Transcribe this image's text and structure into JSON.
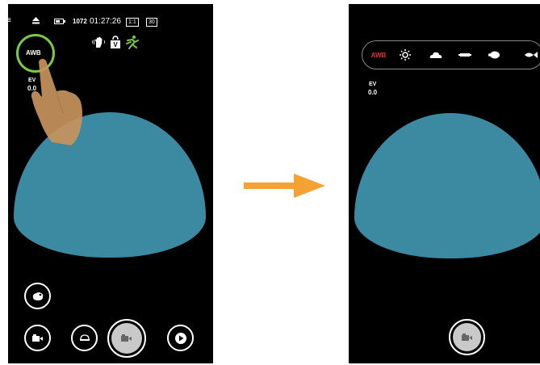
{
  "left": {
    "status": {
      "shots_remaining": "1072",
      "time_remaining": "01:27:26",
      "aspect_ratio": "1:1",
      "frame_rate": "30"
    },
    "awb_button_label": "AWB",
    "ev_label": "EV",
    "ev_value": "0.0"
  },
  "right": {
    "wb_options": {
      "awb_label": "AWB"
    },
    "ev_label": "EV",
    "ev_value": "0.0"
  },
  "colors": {
    "dome": "#3b8aa1",
    "awb_active": "#e0342c",
    "highlight_ring": "#7ac943",
    "arrow": "#f5a234",
    "finger": "#c8935d",
    "scene_icon_green": "#7ac943"
  },
  "icons": [
    "menu-icon",
    "eject-icon",
    "battery-icon",
    "stabilizer-icon",
    "lock-icon",
    "scene-icon",
    "effect-icon",
    "video-mode-icon",
    "dome-lens-icon",
    "shutter-icon",
    "playback-icon",
    "sun-icon",
    "cloudy-icon",
    "fluorescent-icon",
    "incandescent-icon",
    "underwater-icon",
    "arrow-icon",
    "finger-icon"
  ]
}
